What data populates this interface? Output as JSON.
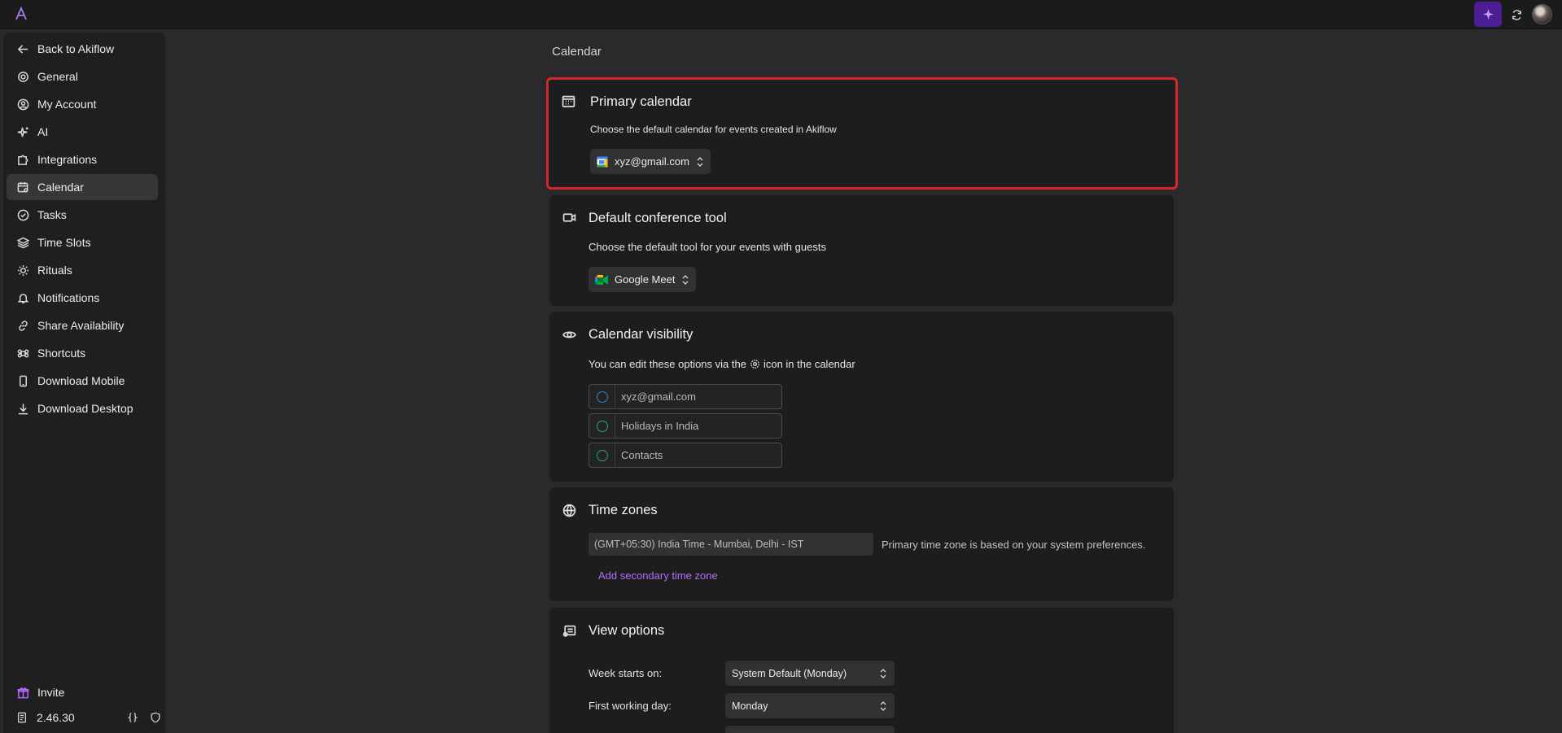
{
  "topbar": {
    "logo_icon": "akiflow-logo-icon",
    "ai_icon": "sparkle-icon",
    "sync_icon": "sync-icon",
    "accent_color": "#4c1d95"
  },
  "sidebar": {
    "items": [
      {
        "label": "Back to Akiflow",
        "icon": "arrow-left-icon"
      },
      {
        "label": "General",
        "icon": "gear-icon"
      },
      {
        "label": "My Account",
        "icon": "user-circle-icon"
      },
      {
        "label": "AI",
        "icon": "sparkle-icon"
      },
      {
        "label": "Integrations",
        "icon": "puzzle-icon"
      },
      {
        "label": "Calendar",
        "icon": "calendar-settings-icon",
        "active": true
      },
      {
        "label": "Tasks",
        "icon": "check-circle-icon"
      },
      {
        "label": "Time Slots",
        "icon": "layers-icon"
      },
      {
        "label": "Rituals",
        "icon": "sun-icon"
      },
      {
        "label": "Notifications",
        "icon": "bell-icon"
      },
      {
        "label": "Share Availability",
        "icon": "link-icon"
      },
      {
        "label": "Shortcuts",
        "icon": "command-icon"
      },
      {
        "label": "Download Mobile",
        "icon": "phone-icon"
      },
      {
        "label": "Download Desktop",
        "icon": "download-icon"
      }
    ],
    "invite_label": "Invite",
    "version": "2.46.30"
  },
  "main": {
    "title": "Calendar",
    "primary_calendar": {
      "heading": "Primary calendar",
      "description": "Choose the default calendar for events created in Akiflow",
      "selected": "xyz@gmail.com"
    },
    "conference": {
      "heading": "Default conference tool",
      "description": "Choose the default tool for your events with guests",
      "selected": "Google Meet"
    },
    "visibility": {
      "heading": "Calendar visibility",
      "description_before": "You can edit these options via the",
      "description_after": "icon in the calendar",
      "calendars": [
        "xyz@gmail.com",
        "Holidays in India",
        "Contacts"
      ]
    },
    "timezones": {
      "heading": "Time zones",
      "primary_value": "(GMT+05:30) India Time - Mumbai, Delhi - IST",
      "note": "Primary time zone is based on your system preferences.",
      "add_link": "Add secondary time zone"
    },
    "view_options": {
      "heading": "View options",
      "week_starts_label": "Week starts on:",
      "week_starts_value": "System Default (Monday)",
      "first_working_label": "First working day:",
      "first_working_value": "Monday"
    }
  },
  "colors": {
    "highlight_border": "#d5262d",
    "link": "#b46cff"
  }
}
